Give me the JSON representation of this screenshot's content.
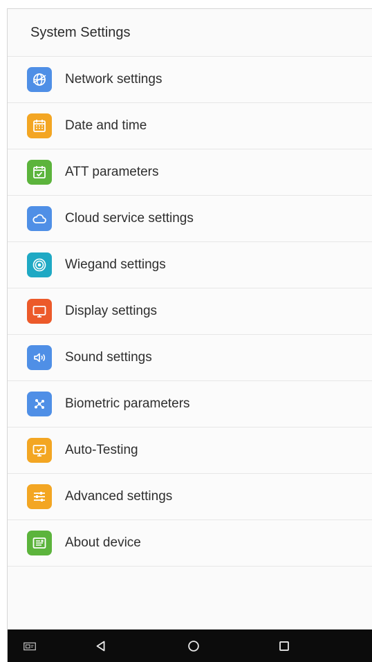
{
  "header": {
    "title": "System Settings"
  },
  "menu": {
    "items": [
      {
        "label": "Network settings",
        "icon": "globe-icon",
        "color": "#4f8fe6"
      },
      {
        "label": "Date and time",
        "icon": "calendar-icon",
        "color": "#f3a623"
      },
      {
        "label": "ATT parameters",
        "icon": "calendar-check-icon",
        "color": "#5cb43c"
      },
      {
        "label": "Cloud service settings",
        "icon": "cloud-icon",
        "color": "#4f8fe6"
      },
      {
        "label": "Wiegand settings",
        "icon": "signal-rings-icon",
        "color": "#1fa9c4"
      },
      {
        "label": "Display settings",
        "icon": "monitor-icon",
        "color": "#ec5a2a"
      },
      {
        "label": "Sound settings",
        "icon": "speaker-icon",
        "color": "#4f8fe6"
      },
      {
        "label": "Biometric parameters",
        "icon": "biometric-network-icon",
        "color": "#4f8fe6"
      },
      {
        "label": "Auto-Testing",
        "icon": "test-screen-icon",
        "color": "#f3a623"
      },
      {
        "label": "Advanced settings",
        "icon": "sliders-icon",
        "color": "#f3a623"
      },
      {
        "label": "About device",
        "icon": "device-info-icon",
        "color": "#5cb43c"
      }
    ]
  },
  "navbar": {
    "buttons": [
      "screenshot-icon",
      "back-icon",
      "home-icon",
      "recents-icon"
    ]
  }
}
